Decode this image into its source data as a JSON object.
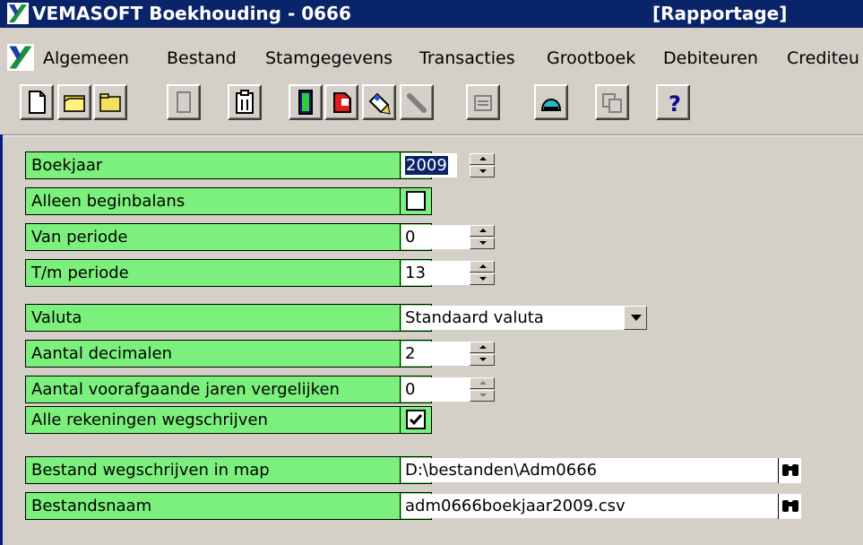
{
  "window": {
    "title": "VEMASOFT Boekhouding - 0666",
    "mode": "[Rapportage]"
  },
  "menu": {
    "items": [
      "Algemeen",
      "Bestand",
      "Stamgegevens",
      "Transacties",
      "Grootboek",
      "Debiteuren",
      "Crediteu"
    ]
  },
  "toolbar": {
    "buttons": [
      {
        "icon": "new-document-icon"
      },
      {
        "icon": "open-folder-icon"
      },
      {
        "icon": "folder-icon"
      },
      {
        "icon": "blank-page-icon"
      },
      {
        "icon": "clipboard-icon"
      },
      {
        "icon": "calculator-icon"
      },
      {
        "icon": "red-file-icon"
      },
      {
        "icon": "pen-edit-icon"
      },
      {
        "icon": "wrench-icon"
      },
      {
        "icon": "report-icon"
      },
      {
        "icon": "user-icon"
      },
      {
        "icon": "copy-icon"
      },
      {
        "icon": "help-icon"
      }
    ]
  },
  "form": {
    "boekjaar": {
      "label": "Boekjaar",
      "value": "2009"
    },
    "alleen_beginbalans": {
      "label": "Alleen beginbalans",
      "checked": false
    },
    "van_periode": {
      "label": "Van periode",
      "value": "0"
    },
    "tm_periode": {
      "label": "T/m periode",
      "value": "13"
    },
    "valuta": {
      "label": "Valuta",
      "value": "Standaard valuta"
    },
    "aantal_decimalen": {
      "label": "Aantal decimalen",
      "value": "2"
    },
    "aantal_jaren": {
      "label": "Aantal voorafgaande jaren vergelijken",
      "value": "0"
    },
    "alle_rekeningen": {
      "label": "Alle rekeningen wegschrijven",
      "checked": true
    },
    "map": {
      "label": "Bestand wegschrijven in map",
      "value": "D:\\bestanden\\Adm0666"
    },
    "bestandsnaam": {
      "label": "Bestandsnaam",
      "value": "adm0666boekjaar2009.csv"
    }
  },
  "colors": {
    "title_bar": "#0a246a",
    "row_background": "#7cf07c",
    "window_background": "#d4d0c8"
  }
}
